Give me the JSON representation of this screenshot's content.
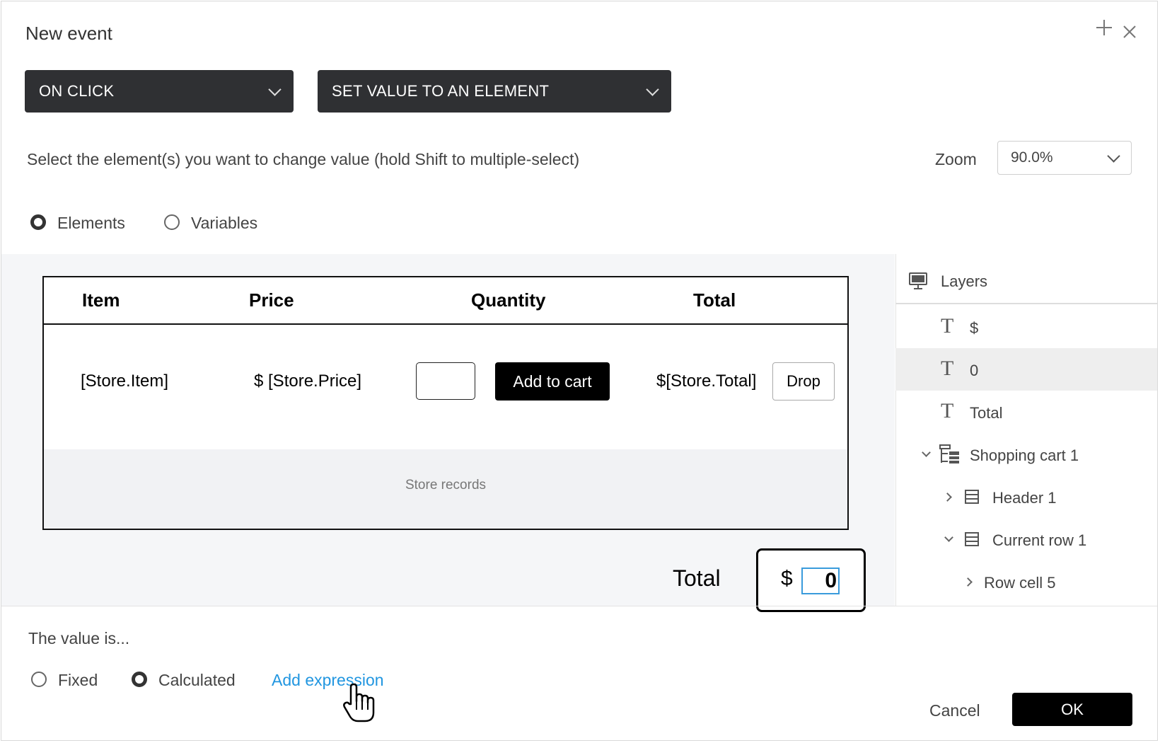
{
  "dialog": {
    "title": "New event",
    "trigger_dropdown": "ON CLICK",
    "action_dropdown": "SET VALUE TO AN ELEMENT",
    "instruction": "Select the element(s) you want to change value (hold Shift to multiple-select)",
    "zoom_label": "Zoom",
    "zoom_value": "90.0%",
    "source_options": [
      {
        "label": "Elements",
        "selected": true
      },
      {
        "label": "Variables",
        "selected": false
      }
    ]
  },
  "preview": {
    "headers": [
      "Item",
      "Price",
      "Quantity",
      "Total"
    ],
    "row": {
      "item": "[Store.Item]",
      "price": "$ [Store.Price]",
      "add_button": "Add to cart",
      "total": "$[Store.Total]",
      "drop_button": "Drop"
    },
    "records_label": "Store records",
    "total_label": "Total",
    "total_currency": "$",
    "total_value": "0"
  },
  "layers": {
    "title": "Layers",
    "items": [
      {
        "label": "$",
        "icon": "text-icon",
        "selected": false
      },
      {
        "label": "0",
        "icon": "text-icon",
        "selected": true
      },
      {
        "label": "Total",
        "icon": "text-icon",
        "selected": false
      },
      {
        "label": "Shopping cart 1",
        "icon": "data-grid-icon",
        "expanded": true
      },
      {
        "label": "Header 1",
        "icon": "row-icon",
        "expanded": false
      },
      {
        "label": "Current row 1",
        "icon": "row-icon",
        "expanded": true
      },
      {
        "label": "Row cell 5",
        "icon": "none",
        "expanded": false
      }
    ]
  },
  "value": {
    "label": "The value is...",
    "options": [
      {
        "label": "Fixed",
        "selected": false
      },
      {
        "label": "Calculated",
        "selected": true
      }
    ],
    "add_expression": "Add expression"
  },
  "footer": {
    "cancel": "Cancel",
    "ok": "OK"
  },
  "colors": {
    "dropdown_bg": "#2f3033",
    "link": "#2196e0",
    "selection_outline": "#3a9bdc"
  }
}
